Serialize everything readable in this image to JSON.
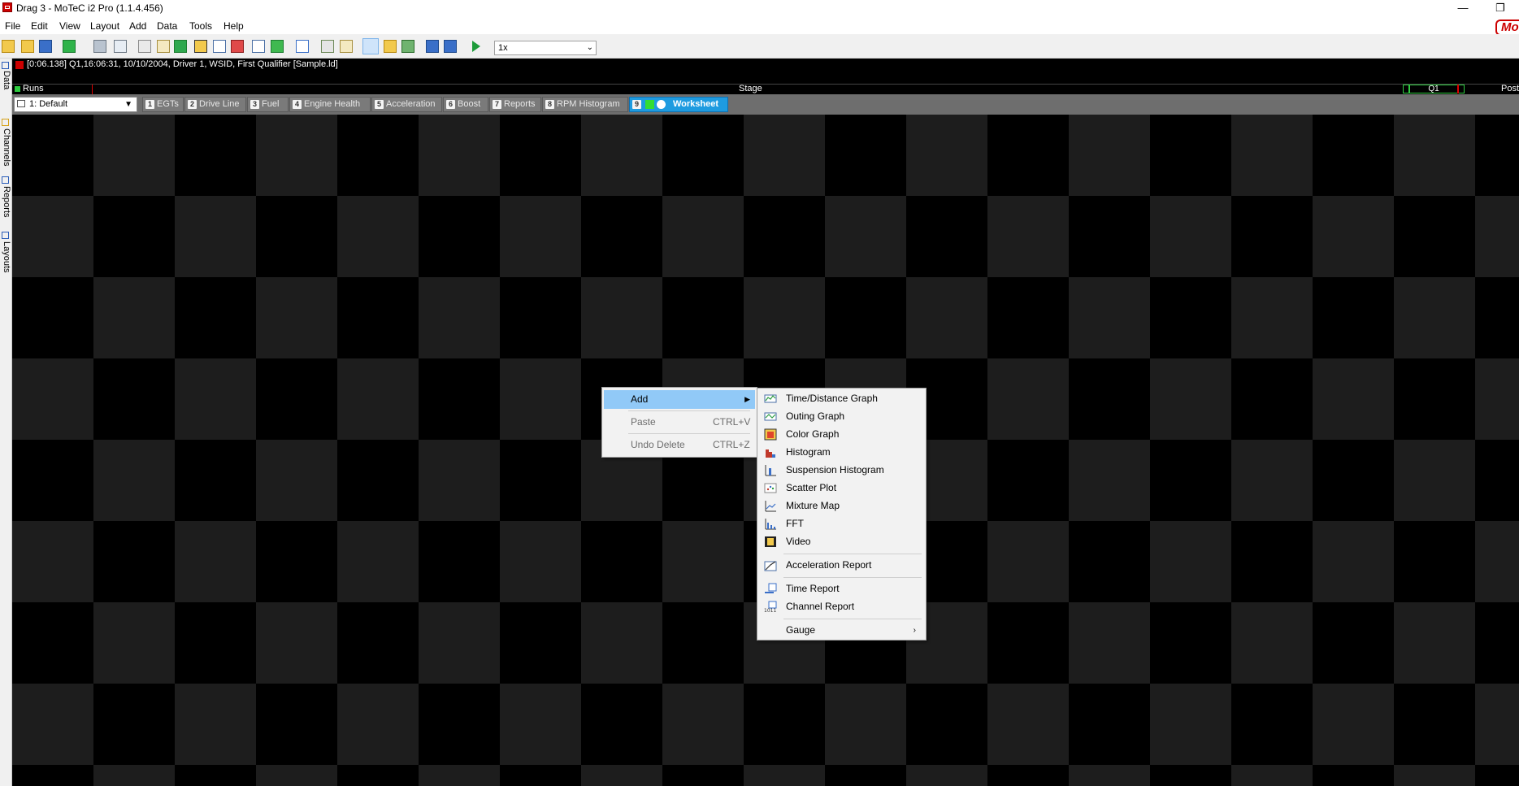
{
  "window": {
    "title": "Drag 3 - MoTeC i2 Pro (1.1.4.456)",
    "controls": {
      "minimize": "—",
      "restore": "❐"
    }
  },
  "menubar": {
    "items": [
      "File",
      "Edit",
      "View",
      "Layout",
      "Add",
      "Data",
      "Tools",
      "Help"
    ],
    "brand": "Mo"
  },
  "toolbar": {
    "speed": {
      "value": "1x"
    }
  },
  "sidebar": {
    "tabs": [
      "Data",
      "Channels",
      "Reports",
      "Layouts"
    ]
  },
  "infobar": {
    "text": "[0:06.138] Q1,16:06:31, 10/10/2004,  Driver 1, WSID, First Qualifier [Sample.ld]"
  },
  "runs": {
    "label": "Runs",
    "stage_label": "Stage",
    "marker": "Q1",
    "post_label": "Post"
  },
  "layout_select": {
    "value": "1: Default"
  },
  "worksheet_tabs": [
    {
      "num": "1",
      "label": "EGTs"
    },
    {
      "num": "2",
      "label": "Drive Line"
    },
    {
      "num": "3",
      "label": "Fuel"
    },
    {
      "num": "4",
      "label": "Engine Health"
    },
    {
      "num": "5",
      "label": "Acceleration"
    },
    {
      "num": "6",
      "label": "Boost"
    },
    {
      "num": "7",
      "label": "Reports"
    },
    {
      "num": "8",
      "label": "RPM Histogram"
    },
    {
      "num": "9",
      "label": "Worksheet",
      "active": true
    }
  ],
  "context_menu": {
    "items": [
      {
        "label": "Add",
        "has_submenu": true,
        "highlighted": true
      },
      {
        "label": "Paste",
        "shortcut": "CTRL+V",
        "disabled": true
      },
      {
        "label": "Undo Delete",
        "shortcut": "CTRL+Z",
        "disabled": true
      }
    ]
  },
  "add_submenu": {
    "items": [
      {
        "label": "Time/Distance Graph",
        "icon": "time-distance-graph-icon"
      },
      {
        "label": "Outing Graph",
        "icon": "outing-graph-icon"
      },
      {
        "label": "Color Graph",
        "icon": "color-graph-icon"
      },
      {
        "label": "Histogram",
        "icon": "histogram-icon"
      },
      {
        "label": "Suspension Histogram",
        "icon": "suspension-histogram-icon"
      },
      {
        "label": "Scatter Plot",
        "icon": "scatter-plot-icon"
      },
      {
        "label": "Mixture Map",
        "icon": "mixture-map-icon"
      },
      {
        "label": "FFT",
        "icon": "fft-icon"
      },
      {
        "label": "Video",
        "icon": "video-icon"
      },
      {
        "label": "Acceleration Report",
        "icon": "acceleration-report-icon"
      },
      {
        "label": "Time Report",
        "icon": "time-report-icon"
      },
      {
        "label": "Channel Report",
        "icon": "channel-report-icon"
      },
      {
        "label": "Gauge",
        "icon": "gauge-icon",
        "has_submenu": true
      }
    ]
  },
  "colors": {
    "accent_tab": "#1e9be0",
    "menu_highlight": "#91c9f7",
    "record_red": "#cc0000",
    "run_green": "#2ecc40"
  }
}
